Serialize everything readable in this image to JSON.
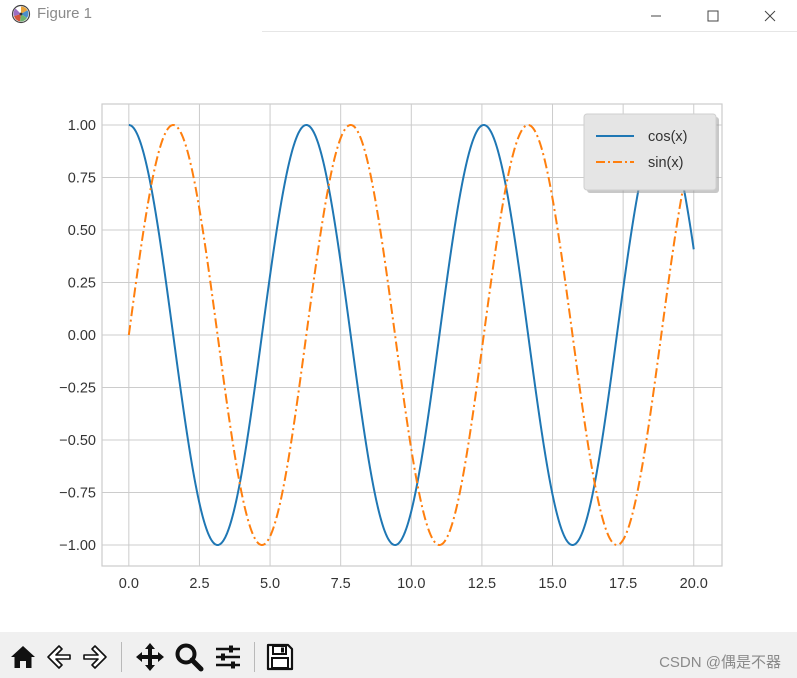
{
  "window": {
    "title": "Figure 1",
    "app_icon": "matplotlib-icon",
    "controls": [
      "minimize-icon",
      "maximize-icon",
      "close-icon"
    ]
  },
  "chart_data": {
    "type": "line",
    "title": "",
    "xlabel": "",
    "ylabel": "",
    "xlim": [
      -0.95,
      21.0
    ],
    "ylim": [
      -1.1,
      1.1
    ],
    "xticks": [
      0.0,
      2.5,
      5.0,
      7.5,
      10.0,
      12.5,
      15.0,
      17.5,
      20.0
    ],
    "xtick_labels": [
      "0.0",
      "2.5",
      "5.0",
      "7.5",
      "10.0",
      "12.5",
      "15.0",
      "17.5",
      "20.0"
    ],
    "yticks": [
      1.0,
      0.75,
      0.5,
      0.25,
      0.0,
      -0.25,
      -0.5,
      -0.75,
      -1.0
    ],
    "ytick_labels": [
      "1.00",
      "0.75",
      "0.50",
      "0.25",
      "0.00",
      "−0.25",
      "−0.50",
      "−0.75",
      "−1.00"
    ],
    "grid": true,
    "legend_position": "top-right",
    "x_range": [
      0,
      20
    ],
    "series": [
      {
        "name": "cos(x)",
        "function": "cos",
        "color": "#1f77b4",
        "linestyle": "solid"
      },
      {
        "name": "sin(x)",
        "function": "sin",
        "color": "#ff7f0e",
        "linestyle": "dashdot"
      }
    ]
  },
  "toolbar": {
    "buttons": [
      "home-icon",
      "back-icon",
      "forward-icon",
      "pan-icon",
      "zoom-icon",
      "configure-subplots-icon",
      "save-icon"
    ]
  },
  "watermark": "CSDN @偶是不器"
}
